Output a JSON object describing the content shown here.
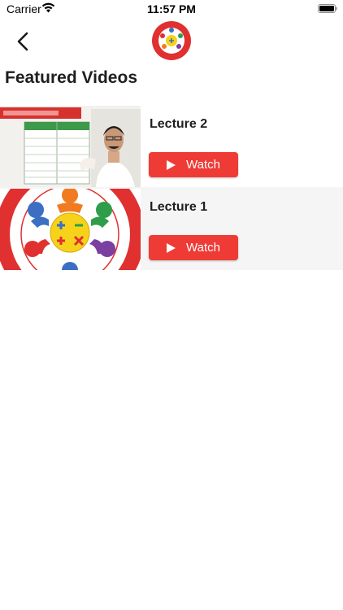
{
  "status": {
    "carrier": "Carrier",
    "time": "11:57 PM"
  },
  "nav": {
    "back_icon": "chevron-left-icon",
    "logo": "sachin-dhawale-logo"
  },
  "title": "Featured Videos",
  "videos": [
    {
      "title": "Lecture 2",
      "watch_label": "Watch",
      "thumbnail": "lecture-video-frame"
    },
    {
      "title": "Lecture 1",
      "watch_label": "Watch",
      "thumbnail": "academy-logo"
    }
  ],
  "colors": {
    "accent": "#ee3b36",
    "alt_row": "#f5f5f5",
    "text": "#1e1e1e"
  }
}
